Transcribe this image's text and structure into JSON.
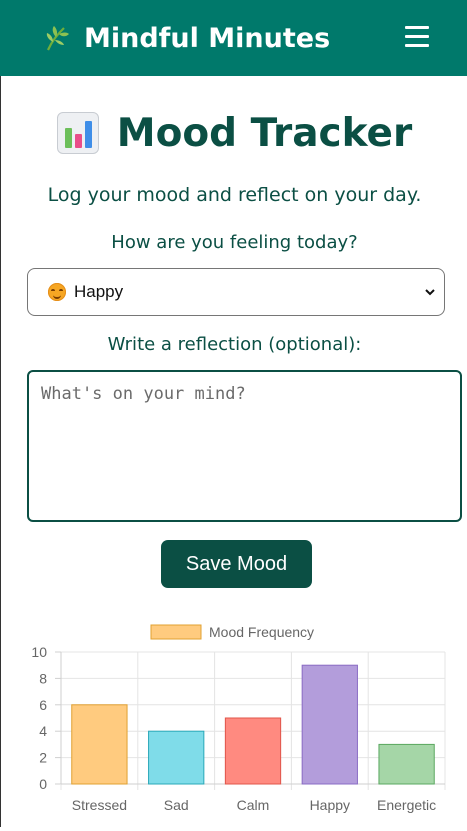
{
  "header": {
    "brand_title": "Mindful Minutes",
    "brand_icon": "herb-leaf-icon",
    "menu_icon": "hamburger-menu-icon"
  },
  "page": {
    "title": "Mood Tracker",
    "title_icon": "bar-chart-icon",
    "subtitle": "Log your mood and reflect on your day."
  },
  "form": {
    "mood_label": "How are you feeling today?",
    "mood_selected": "Happy",
    "mood_selected_icon": "smiling-face-icon",
    "reflection_label": "Write a reflection (optional):",
    "reflection_value": "",
    "reflection_placeholder": "What's on your mind?",
    "save_label": "Save Mood"
  },
  "colors": {
    "header_bg": "#00796b",
    "primary_dark": "#0b4f44"
  },
  "chart_data": {
    "type": "bar",
    "categories": [
      "Stressed",
      "Sad",
      "Calm",
      "Happy",
      "Energetic"
    ],
    "series": [
      {
        "name": "Mood Frequency",
        "values": [
          6,
          4,
          5,
          9,
          3
        ]
      }
    ],
    "bar_colors": [
      "#ffcb7f",
      "#7fdce9",
      "#ff8a80",
      "#b39ddb",
      "#a5d6a7"
    ],
    "legend_swatch_color": "#ffcb7f",
    "legend_position": "top",
    "ylim": [
      0,
      10
    ],
    "yticks": [
      0,
      2,
      4,
      6,
      8,
      10
    ],
    "grid": true
  }
}
